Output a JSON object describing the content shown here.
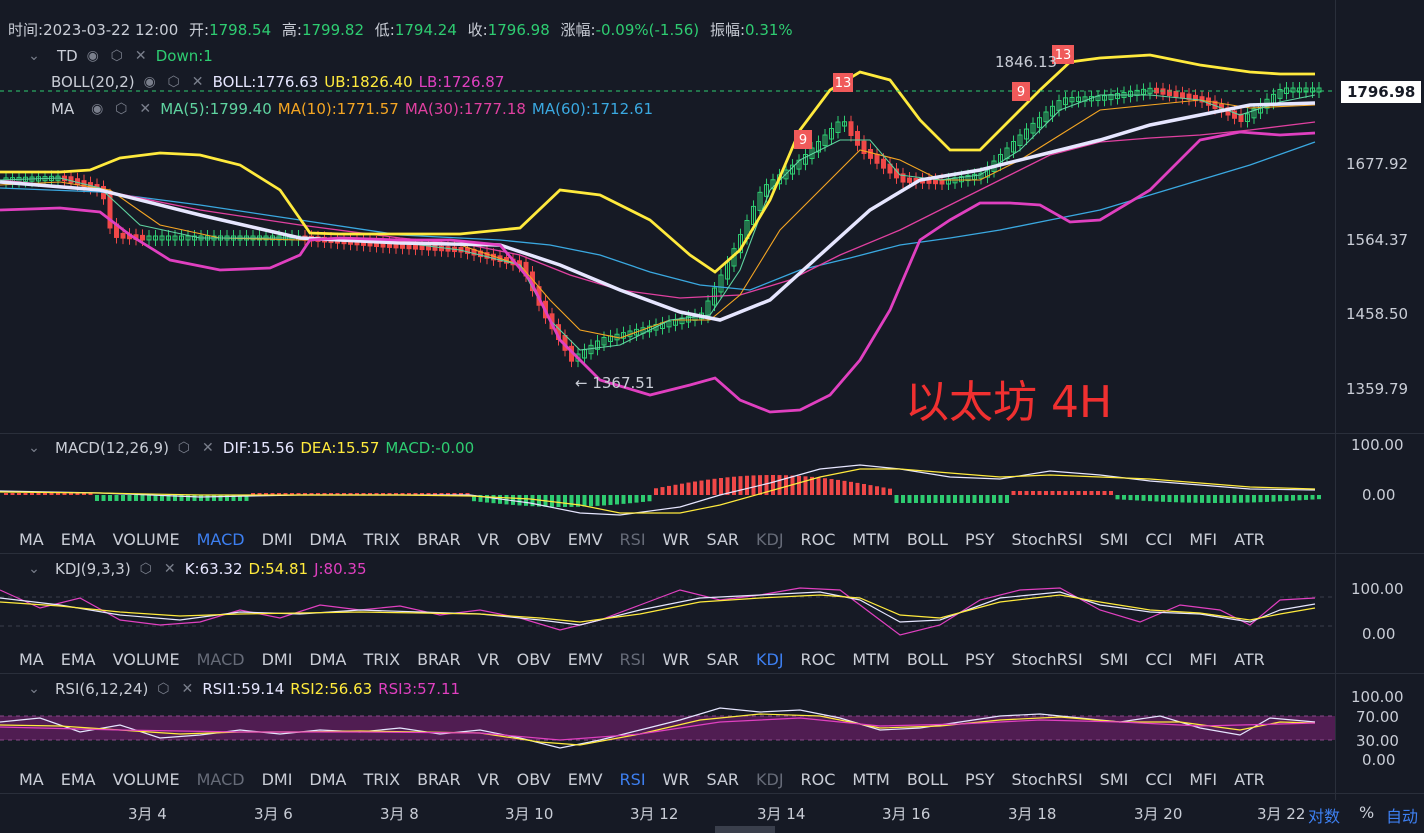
{
  "header": {
    "time_label": "时间:",
    "time": "2023-03-22 12:00",
    "open_label": "开:",
    "open": "1798.54",
    "high_label": "高:",
    "high": "1799.82",
    "low_label": "低:",
    "low": "1794.24",
    "close_label": "收:",
    "close": "1796.98",
    "change_label": "涨幅:",
    "change": "-0.09%(-1.56)",
    "amp_label": "振幅:",
    "amp": "0.31%"
  },
  "indicators": {
    "td": {
      "name": "TD",
      "value": "Down:1"
    },
    "boll": {
      "name": "BOLL(20,2)",
      "boll": "BOLL:1776.63",
      "ub": "UB:1826.40",
      "lb": "LB:1726.87"
    },
    "ma": {
      "name": "MA",
      "ma5": "MA(5):1799.40",
      "ma10": "MA(10):1771.57",
      "ma30": "MA(30):1777.18",
      "ma60": "MA(60):1712.61"
    },
    "macd": {
      "name": "MACD(12,26,9)",
      "dif": "DIF:15.56",
      "dea": "DEA:15.57",
      "macd": "MACD:-0.00"
    },
    "kdj": {
      "name": "KDJ(9,3,3)",
      "k": "K:63.32",
      "d": "D:54.81",
      "j": "J:80.35"
    },
    "rsi": {
      "name": "RSI(6,12,24)",
      "rsi1": "RSI1:59.14",
      "rsi2": "RSI2:56.63",
      "rsi3": "RSI3:57.11"
    }
  },
  "main_chart": {
    "y_ticks": [
      "1677.92",
      "1564.37",
      "1458.50",
      "1359.79"
    ],
    "current_price": "1796.98",
    "high_annotation": "1846.13",
    "low_annotation": "← 1367.51",
    "watermark": "以太坊 4H",
    "td_marks": [
      "13",
      "9",
      "13",
      "9"
    ]
  },
  "macd_axis": [
    "100.00",
    "0.00"
  ],
  "kdj_axis": [
    "100.00",
    "0.00"
  ],
  "rsi_axis": [
    "100.00",
    "70.00",
    "30.00",
    "0.00"
  ],
  "tabs": [
    "MA",
    "EMA",
    "VOLUME",
    "MACD",
    "DMI",
    "DMA",
    "TRIX",
    "BRAR",
    "VR",
    "OBV",
    "EMV",
    "RSI",
    "WR",
    "SAR",
    "KDJ",
    "ROC",
    "MTM",
    "BOLL",
    "PSY",
    "StochRSI",
    "SMI",
    "CCI",
    "MFI",
    "ATR"
  ],
  "x_axis": [
    "3月 4",
    "3月 6",
    "3月 8",
    "3月 10",
    "3月 12",
    "3月 14",
    "3月 16",
    "3月 18",
    "3月 20",
    "3月 22"
  ],
  "bottom_controls": {
    "log": "对数",
    "percent": "%",
    "auto": "自动"
  },
  "colors": {
    "up": "#2ecc71",
    "down": "#f04848",
    "ma5": "#5fd3a0",
    "ma10": "#f5a623",
    "ma30": "#e040a0",
    "ma60": "#3aa8e0",
    "boll_mid": "#e6e6ff",
    "band": "#ffea3d",
    "lb": "#e040c0",
    "accent": "#3d7ff0"
  }
}
